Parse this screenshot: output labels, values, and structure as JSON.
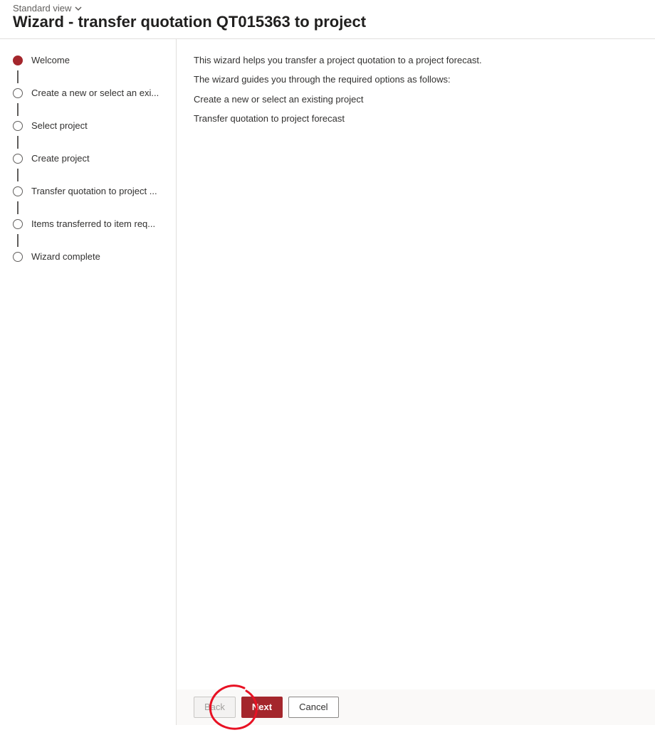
{
  "header": {
    "view_label": "Standard view",
    "title": "Wizard - transfer quotation QT015363 to project"
  },
  "sidebar": {
    "steps": [
      {
        "label": "Welcome",
        "active": true
      },
      {
        "label": "Create a new or select an exi...",
        "active": false
      },
      {
        "label": "Select project",
        "active": false
      },
      {
        "label": "Create project",
        "active": false
      },
      {
        "label": "Transfer quotation to project ...",
        "active": false
      },
      {
        "label": "Items transferred to item req...",
        "active": false
      },
      {
        "label": "Wizard complete",
        "active": false
      }
    ]
  },
  "main": {
    "lines": [
      "This wizard helps you transfer a project quotation to a project forecast.",
      "The wizard guides you through the required options as follows:",
      "Create a new or select an existing project",
      "Transfer quotation to project forecast"
    ]
  },
  "footer": {
    "back_label": "Back",
    "next_label": "Next",
    "cancel_label": "Cancel"
  },
  "colors": {
    "accent": "#a4262c",
    "annotation": "#e81123"
  }
}
